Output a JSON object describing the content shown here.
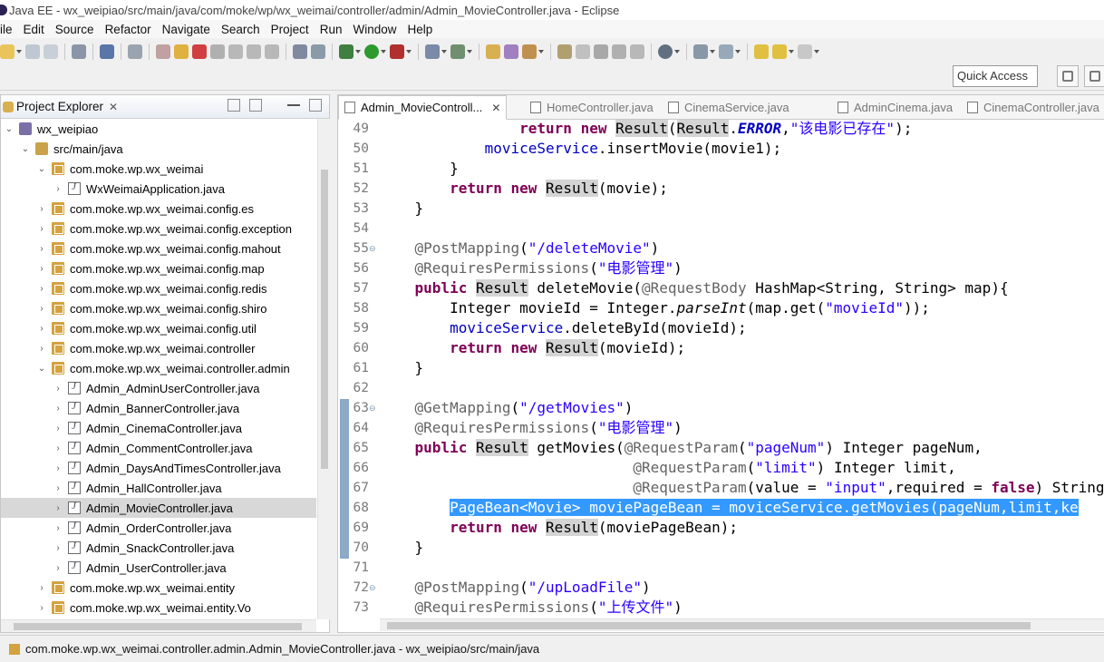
{
  "window": {
    "title": "Java EE - wx_weipiao/src/main/java/com/moke/wp/wx_weimai/controller/admin/Admin_MovieController.java - Eclipse"
  },
  "menu": [
    "ile",
    "Edit",
    "Source",
    "Refactor",
    "Navigate",
    "Search",
    "Project",
    "Run",
    "Window",
    "Help"
  ],
  "toolbar": {
    "quick_access": "Quick Access"
  },
  "explorer": {
    "title": "Project Explorer",
    "close": "✕",
    "items": [
      {
        "label": "wx_weipiao",
        "icon": "project-icon",
        "expanded": true
      },
      {
        "label": "src/main/java",
        "icon": "source-folder-icon",
        "expanded": true
      },
      {
        "label": "com.moke.wp.wx_weimai",
        "icon": "package-icon",
        "expanded": true
      },
      {
        "label": "WxWeimaiApplication.java",
        "icon": "java-file-icon",
        "expanded": false
      },
      {
        "label": "com.moke.wp.wx_weimai.config.es",
        "icon": "package-icon",
        "expanded": false
      },
      {
        "label": "com.moke.wp.wx_weimai.config.exception",
        "icon": "package-icon",
        "expanded": false
      },
      {
        "label": "com.moke.wp.wx_weimai.config.mahout",
        "icon": "package-icon",
        "expanded": false
      },
      {
        "label": "com.moke.wp.wx_weimai.config.map",
        "icon": "package-icon",
        "expanded": false
      },
      {
        "label": "com.moke.wp.wx_weimai.config.redis",
        "icon": "package-icon",
        "expanded": false
      },
      {
        "label": "com.moke.wp.wx_weimai.config.shiro",
        "icon": "package-icon",
        "expanded": false
      },
      {
        "label": "com.moke.wp.wx_weimai.config.util",
        "icon": "package-icon",
        "expanded": false
      },
      {
        "label": "com.moke.wp.wx_weimai.controller",
        "icon": "package-icon",
        "expanded": false
      },
      {
        "label": "com.moke.wp.wx_weimai.controller.admin",
        "icon": "package-icon",
        "expanded": true
      },
      {
        "label": "Admin_AdminUserController.java",
        "icon": "java-file-icon",
        "expanded": false
      },
      {
        "label": "Admin_BannerController.java",
        "icon": "java-file-icon",
        "expanded": false
      },
      {
        "label": "Admin_CinemaController.java",
        "icon": "java-file-icon",
        "expanded": false
      },
      {
        "label": "Admin_CommentController.java",
        "icon": "java-file-icon",
        "expanded": false
      },
      {
        "label": "Admin_DaysAndTimesController.java",
        "icon": "java-file-icon",
        "expanded": false
      },
      {
        "label": "Admin_HallController.java",
        "icon": "java-file-icon",
        "expanded": false
      },
      {
        "label": "Admin_MovieController.java",
        "icon": "java-file-icon",
        "expanded": false,
        "selected": true
      },
      {
        "label": "Admin_OrderController.java",
        "icon": "java-file-icon",
        "expanded": false
      },
      {
        "label": "Admin_SnackController.java",
        "icon": "java-file-icon",
        "expanded": false
      },
      {
        "label": "Admin_UserController.java",
        "icon": "java-file-icon",
        "expanded": false
      },
      {
        "label": "com.moke.wp.wx_weimai.entity",
        "icon": "package-icon",
        "expanded": false
      },
      {
        "label": "com.moke.wp.wx_weimai.entity.Vo",
        "icon": "package-icon",
        "expanded": false
      }
    ]
  },
  "editor": {
    "tabs": [
      {
        "label": "Admin_MovieControll...",
        "active": true
      },
      {
        "label": "HomeController.java",
        "active": false
      },
      {
        "label": "CinemaService.java",
        "active": false
      },
      {
        "label": "AdminCinema.java",
        "active": false
      },
      {
        "label": "CinemaController.java",
        "active": false
      }
    ],
    "lines": [
      {
        "n": "49",
        "html": "                <span class=\"kw\">return</span> <span class=\"kw\">new</span> <span class=\"occ\">Result</span>(<span class=\"occ\">Result</span>.<span class=\"fld ital\" style=\"font-weight:bold\">ERROR</span>,<span class=\"str\">\"该电影已存在\"</span>);"
      },
      {
        "n": "50",
        "html": "            <span class=\"fld\">moviceService</span>.insertMovie(movie1);"
      },
      {
        "n": "51",
        "html": "        }"
      },
      {
        "n": "52",
        "html": "        <span class=\"kw\">return</span> <span class=\"kw\">new</span> <span class=\"occ\">Result</span>(movie);"
      },
      {
        "n": "53",
        "html": "    }"
      },
      {
        "n": "54",
        "html": ""
      },
      {
        "n": "55",
        "html": "    <span class=\"an\">@PostMapping</span>(<span class=\"str\">\"/deleteMovie\"</span>)",
        "fold": true
      },
      {
        "n": "56",
        "html": "    <span class=\"an\">@RequiresPermissions</span>(<span class=\"str\">\"电影管理\"</span>)"
      },
      {
        "n": "57",
        "html": "    <span class=\"kw\">public</span> <span class=\"occ\">Result</span> deleteMovie(<span class=\"an\">@RequestBody</span> HashMap&lt;String, String&gt; map){"
      },
      {
        "n": "58",
        "html": "        Integer movieId = Integer.<span class=\"ital\">parseInt</span>(map.get(<span class=\"str\">\"movieId\"</span>));"
      },
      {
        "n": "59",
        "html": "        <span class=\"fld\">moviceService</span>.deleteById(movieId);"
      },
      {
        "n": "60",
        "html": "        <span class=\"kw\">return</span> <span class=\"kw\">new</span> <span class=\"occ\">Result</span>(movieId);"
      },
      {
        "n": "61",
        "html": "    }"
      },
      {
        "n": "62",
        "html": ""
      },
      {
        "n": "63",
        "html": "    <span class=\"an\">@GetMapping</span>(<span class=\"str\">\"/getMovies\"</span>)",
        "fold": true
      },
      {
        "n": "64",
        "html": "    <span class=\"an\">@RequiresPermissions</span>(<span class=\"str\">\"电影管理\"</span>)"
      },
      {
        "n": "65",
        "html": "    <span class=\"kw\">public</span> <span class=\"occ\">Result</span> getMovies(<span class=\"an\">@RequestParam</span>(<span class=\"str\">\"pageNum\"</span>) Integer pageNum,"
      },
      {
        "n": "66",
        "html": "                             <span class=\"an\">@RequestParam</span>(<span class=\"str\">\"limit\"</span>) Integer limit,"
      },
      {
        "n": "67",
        "html": "                             <span class=\"an\">@RequestParam</span>(value = <span class=\"str\">\"input\"</span>,required = <span class=\"kw\">false</span>) String"
      },
      {
        "n": "68",
        "html": "        <span class=\"sel\">PageBean&lt;Movie&gt; moviePageBean = moviceService.getMovies(pageNum,limit,ke</span>",
        "selected": true
      },
      {
        "n": "69",
        "html": "        <span class=\"kw\">return</span> <span class=\"kw\">new</span> <span class=\"occ\">Result</span>(moviePageBean);"
      },
      {
        "n": "70",
        "html": "    }"
      },
      {
        "n": "71",
        "html": ""
      },
      {
        "n": "72",
        "html": "    <span class=\"an\">@PostMapping</span>(<span class=\"str\">\"/upLoadFile\"</span>)",
        "fold": true
      },
      {
        "n": "73",
        "html": "    <span class=\"an\">@RequiresPermissions</span>(<span class=\"str\">\"上传文件\"</span>)"
      }
    ]
  },
  "status": {
    "text": "com.moke.wp.wx_weimai.controller.admin.Admin_MovieController.java - wx_weipiao/src/main/java"
  }
}
